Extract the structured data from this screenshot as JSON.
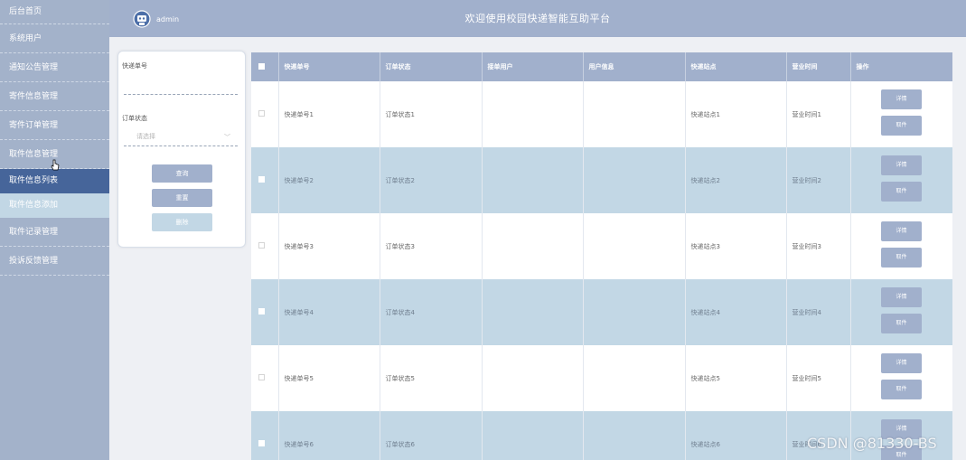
{
  "sidebar": {
    "items": [
      {
        "label": "后台首页"
      },
      {
        "label": "系统用户"
      },
      {
        "label": "通知公告管理"
      },
      {
        "label": "寄件信息管理"
      },
      {
        "label": "寄件订单管理"
      },
      {
        "label": "取件信息管理"
      }
    ],
    "sub_items": [
      {
        "label": "取件信息列表"
      },
      {
        "label": "取件信息添加"
      }
    ],
    "items_after": [
      {
        "label": "取件记录管理"
      },
      {
        "label": "投诉反馈管理"
      }
    ]
  },
  "header": {
    "user": "admin",
    "title": "欢迎使用校园快递智能互助平台"
  },
  "search": {
    "field1_label": "快递单号",
    "field1_value": "",
    "field2_label": "订单状态",
    "field2_placeholder": "请选择",
    "query_button": "查询",
    "reset_button": "重置",
    "delete_button": "删除"
  },
  "table": {
    "columns": [
      "快递单号",
      "订单状态",
      "接单用户",
      "用户信息",
      "快递站点",
      "营业时间",
      "操作"
    ],
    "rows": [
      {
        "no": "快递单号1",
        "status": "订单状态1",
        "user": "",
        "info": "",
        "station": "快递站点1",
        "hours": "营业时间1"
      },
      {
        "no": "快递单号2",
        "status": "订单状态2",
        "user": "",
        "info": "",
        "station": "快递站点2",
        "hours": "营业时间2"
      },
      {
        "no": "快递单号3",
        "status": "订单状态3",
        "user": "",
        "info": "",
        "station": "快递站点3",
        "hours": "营业时间3"
      },
      {
        "no": "快递单号4",
        "status": "订单状态4",
        "user": "",
        "info": "",
        "station": "快递站点4",
        "hours": "营业时间4"
      },
      {
        "no": "快递单号5",
        "status": "订单状态5",
        "user": "",
        "info": "",
        "station": "快递站点5",
        "hours": "营业时间5"
      },
      {
        "no": "快递单号6",
        "status": "订单状态6",
        "user": "",
        "info": "",
        "station": "快递站点6",
        "hours": "营业时间6"
      }
    ],
    "detail_button": "详情",
    "pickup_button": "取件"
  },
  "watermark": "CSDN @81330-BS",
  "colors": {
    "sidebar_bg": "#a3b2ca",
    "active_bg": "#46659a",
    "row_alt_bg": "#c2d7e5",
    "header_bg": "#a1b0cc"
  }
}
